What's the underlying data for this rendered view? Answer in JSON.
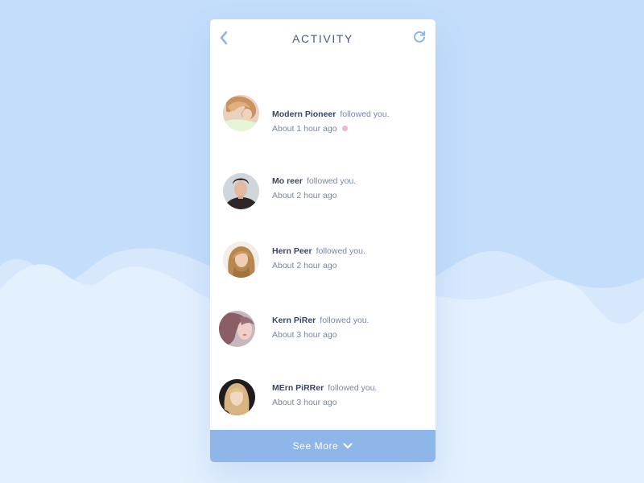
{
  "header": {
    "title": "ACTIVITY",
    "back_icon": "chevron-left-icon",
    "refresh_icon": "refresh-icon"
  },
  "activities": [
    {
      "name": "Modern Pioneer",
      "action": "followed you.",
      "time": "About 1 hour ago",
      "unread": true
    },
    {
      "name": "Mo reer",
      "action": "followed you.",
      "time": "About 2 hour ago",
      "unread": false
    },
    {
      "name": "Hern Peer",
      "action": "followed you.",
      "time": "About 2 hour ago",
      "unread": false
    },
    {
      "name": "Kern PiRer",
      "action": "followed you.",
      "time": "About 3 hour ago",
      "unread": false
    },
    {
      "name": "MErn PiRRer",
      "action": "followed you.",
      "time": "About 3 hour ago",
      "unread": false
    }
  ],
  "footer": {
    "see_more_label": "See More",
    "icon": "chevron-down-icon"
  },
  "colors": {
    "background": "#c3ddfb",
    "accent": "#8fb6e9",
    "unread_dot": "#f4b3d3",
    "name_text": "#3a4566",
    "meta_text": "#7a86a0"
  }
}
